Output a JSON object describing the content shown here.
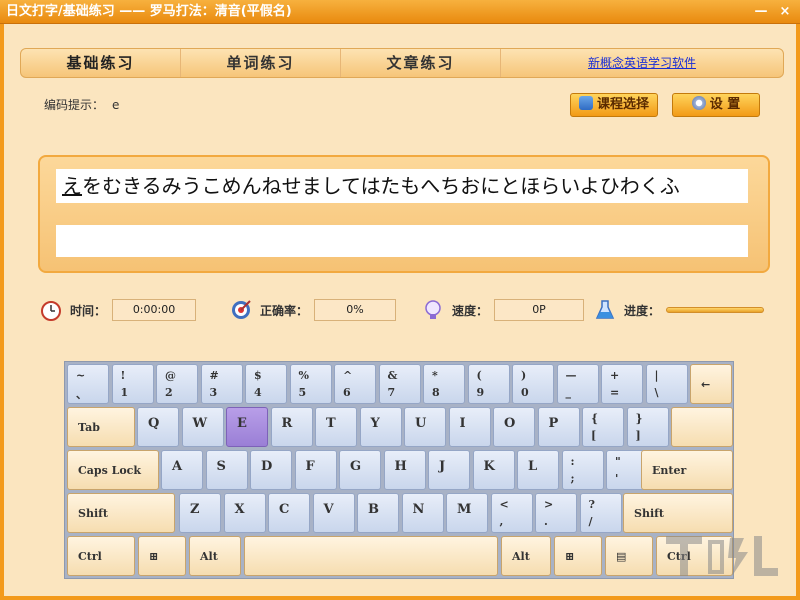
{
  "window": {
    "title": "日文打字/基础练习 —— 罗马打法：清音(平假名)",
    "min": "—",
    "close": "×"
  },
  "tabs": [
    {
      "label": "基础练习"
    },
    {
      "label": "单词练习"
    },
    {
      "label": "文章练习"
    }
  ],
  "promo_link": "新概念英语学习软件",
  "hint": {
    "label": "编码提示：",
    "value": "e"
  },
  "buttons": {
    "course": "课程选择",
    "settings": "设 置"
  },
  "practice": {
    "current_char": "え",
    "rest_text": "をむきるみうこめんねせましてはたもへちおにとほらいよひわくふ"
  },
  "stats": {
    "time_label": "时间：",
    "time_value": "0:00:00",
    "accuracy_label": "正确率：",
    "accuracy_value": "0%",
    "speed_label": "速度：",
    "speed_value": "0P",
    "progress_label": "进度：",
    "progress_fraction": 1.0
  },
  "keyboard": {
    "highlighted_key": "E",
    "row1": [
      {
        "up": "~",
        "dn": "、"
      },
      {
        "up": "!",
        "dn": "1"
      },
      {
        "up": "@",
        "dn": "2"
      },
      {
        "up": "#",
        "dn": "3"
      },
      {
        "up": "$",
        "dn": "4"
      },
      {
        "up": "%",
        "dn": "5"
      },
      {
        "up": "^",
        "dn": "6"
      },
      {
        "up": "&",
        "dn": "7"
      },
      {
        "up": "*",
        "dn": "8"
      },
      {
        "up": "(",
        "dn": "9"
      },
      {
        "up": ")",
        "dn": "0"
      },
      {
        "up": "—",
        "dn": "_"
      },
      {
        "up": "+",
        "dn": "="
      },
      {
        "up": "|",
        "dn": "\\"
      }
    ],
    "backspace": "←",
    "tab": "Tab",
    "row2": [
      "Q",
      "W",
      "E",
      "R",
      "T",
      "Y",
      "U",
      "I",
      "O",
      "P"
    ],
    "row2_sym": [
      {
        "up": "{",
        "dn": "["
      },
      {
        "up": "}",
        "dn": "]"
      }
    ],
    "caps": "Caps Lock",
    "row3": [
      "A",
      "S",
      "D",
      "F",
      "G",
      "H",
      "J",
      "K",
      "L"
    ],
    "row3_sym": [
      {
        "up": ":",
        "dn": ";"
      },
      {
        "up": "\"",
        "dn": "'"
      }
    ],
    "enter": "Enter",
    "shift": "Shift",
    "row4": [
      "Z",
      "X",
      "C",
      "V",
      "B",
      "N",
      "M"
    ],
    "row4_sym": [
      {
        "up": "<",
        "dn": ","
      },
      {
        "up": ">",
        "dn": "."
      },
      {
        "up": "?",
        "dn": "/"
      }
    ],
    "ctrl": "Ctrl",
    "alt": "Alt"
  },
  "colors": {
    "accent": "#f39a1b",
    "key_active": "#9a7fd6",
    "link": "#1a2fd6"
  },
  "icons": [
    "clock-icon",
    "target-icon",
    "bulb-icon",
    "flask-icon",
    "course-icon",
    "settings-icon",
    "windows-icon",
    "menu-icon"
  ]
}
